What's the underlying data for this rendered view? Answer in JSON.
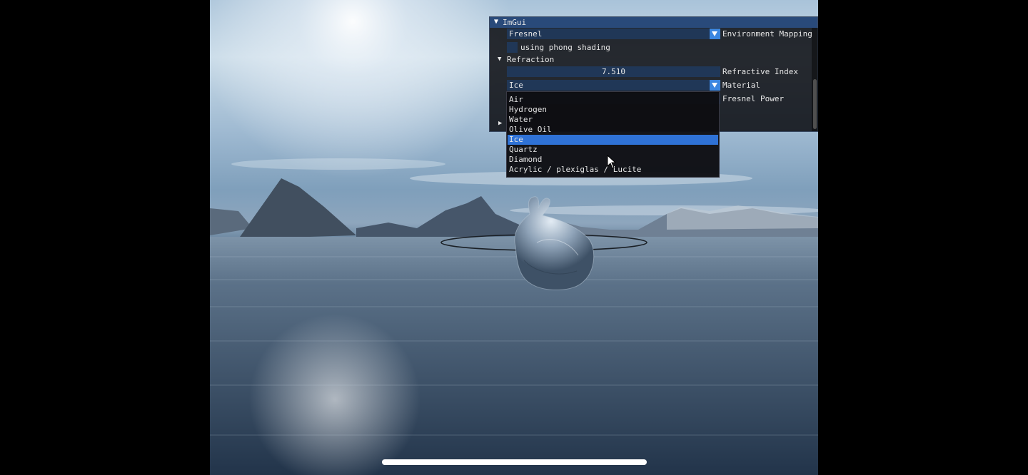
{
  "window": {
    "title": "ImGui"
  },
  "env_combo": {
    "value": "Fresnel",
    "label": "Environment Mapping"
  },
  "phong_checkbox": {
    "label": "using phong shading",
    "checked": false
  },
  "refraction_node": {
    "label": "Refraction"
  },
  "refractive_index": {
    "value": "7.510",
    "label": "Refractive Index"
  },
  "material_combo": {
    "value": "Ice",
    "label": "Material",
    "options": [
      "Air",
      "Hydrogen",
      "Water",
      "Olive Oil",
      "Ice",
      "Quartz",
      "Diamond",
      "Acrylic / plexiglas / Lucite"
    ],
    "selected": "Ice"
  },
  "fresnel_power": {
    "label": "Fresnel Power"
  },
  "colors": {
    "accent": "#3b86e0",
    "frame": "#203757",
    "titlebar": "#294a7a",
    "selected": "#2f72d6"
  }
}
